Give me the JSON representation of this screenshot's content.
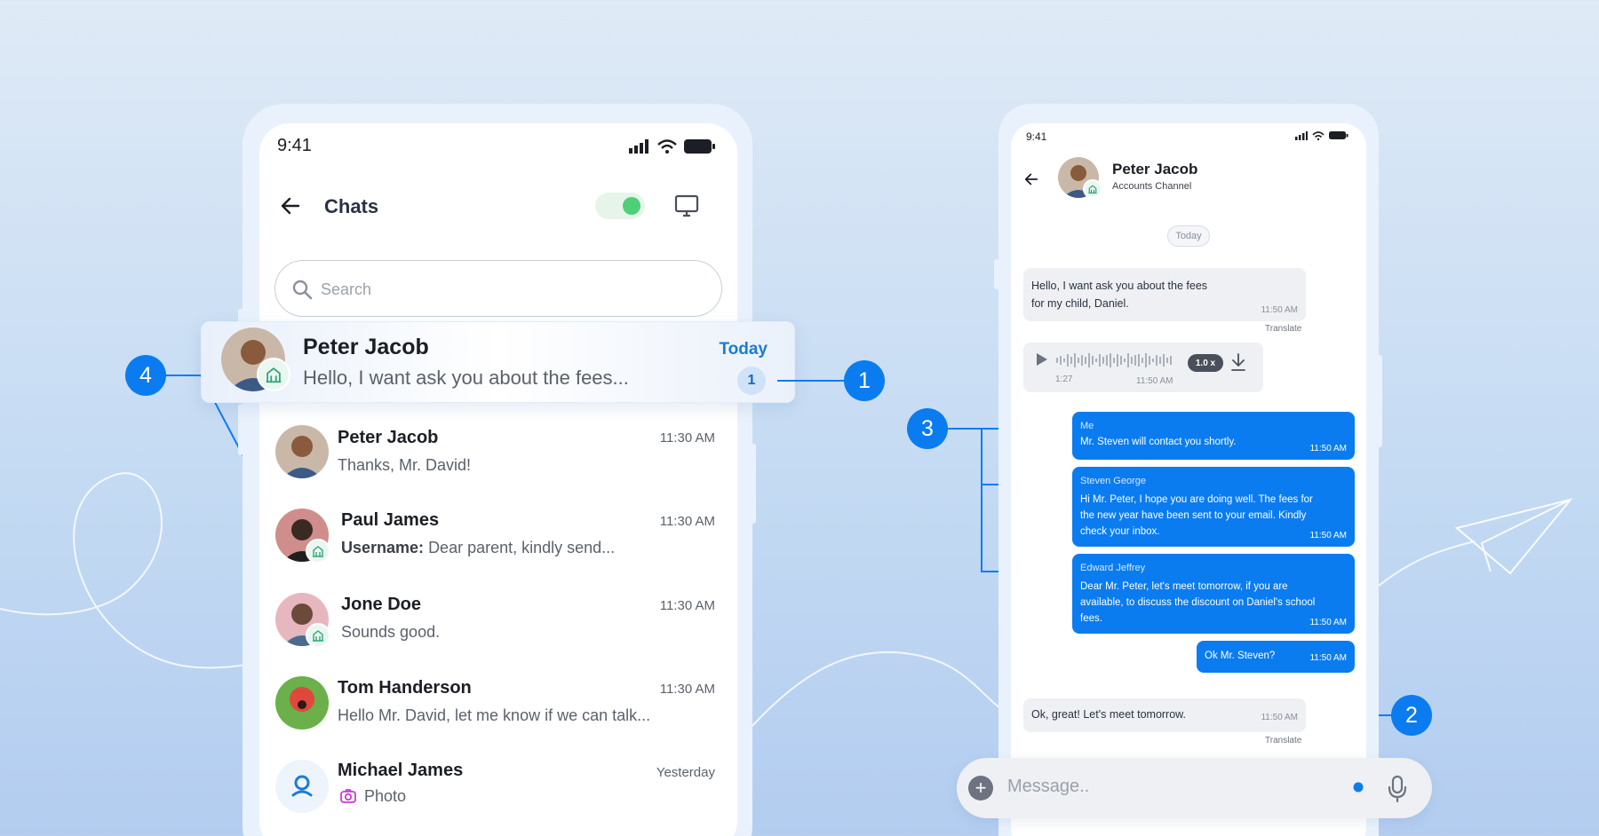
{
  "left_phone": {
    "status_time": "9:41",
    "header": {
      "title": "Chats"
    },
    "search": {
      "placeholder": "Search"
    },
    "highlighted": {
      "name": "Peter Jacob",
      "message": "Hello, I want ask you about the fees...",
      "time": "Today",
      "unread": "1"
    },
    "chats": [
      {
        "name": "Peter Jacob",
        "message": "Thanks, Mr. David!",
        "time": "11:30 AM"
      },
      {
        "name": "Paul James",
        "prefix": "Username:",
        "message": "Dear parent, kindly send...",
        "time": "11:30 AM"
      },
      {
        "name": "Jone Doe",
        "message": "Sounds good.",
        "time": "11:30 AM"
      },
      {
        "name": "Tom Handerson",
        "message": "Hello Mr. David, let me know if we can talk...",
        "time": "11:30 AM"
      },
      {
        "name": "Michael James",
        "message": "Photo",
        "time": "Yesterday"
      }
    ]
  },
  "right_phone": {
    "status_time": "9:41",
    "header": {
      "name": "Peter Jacob",
      "subtitle": "Accounts Channel"
    },
    "date_chip": "Today",
    "messages": [
      {
        "text_line1": "Hello, I want ask you about the fees",
        "text_line2": "for my child, Daniel.",
        "time": "11:50 AM",
        "translate": "Translate"
      },
      {
        "voice_duration": "1:27",
        "speed": "1.0 x",
        "time": "11:50 AM"
      },
      {
        "sender": "Me",
        "text": "Mr. Steven will contact you shortly.",
        "time": "11:50 AM"
      },
      {
        "sender": "Steven George",
        "lines": [
          "Hi Mr. Peter, I hope you are doing well. The fees for",
          "the new year have been sent to your email. Kindly",
          "check your inbox."
        ],
        "time": "11:50 AM"
      },
      {
        "sender": "Edward Jeffrey",
        "lines": [
          "Dear Mr. Peter, let's meet tomorrow, if you are",
          "available, to discuss the discount on Daniel's school",
          "fees."
        ],
        "time": "11:50 AM"
      },
      {
        "text": "Ok Mr. Steven?",
        "time": "11:50 AM"
      },
      {
        "text": "Ok, great! Let's meet tomorrow.",
        "time": "11:50 AM",
        "translate": "Translate"
      }
    ],
    "input": {
      "placeholder": "Message.."
    }
  },
  "callouts": [
    "1",
    "2",
    "3",
    "4"
  ],
  "colors": {
    "accent": "#0a7cf0",
    "toggle_on": "#4fcf77",
    "bubble_in": "#eef0f3"
  }
}
